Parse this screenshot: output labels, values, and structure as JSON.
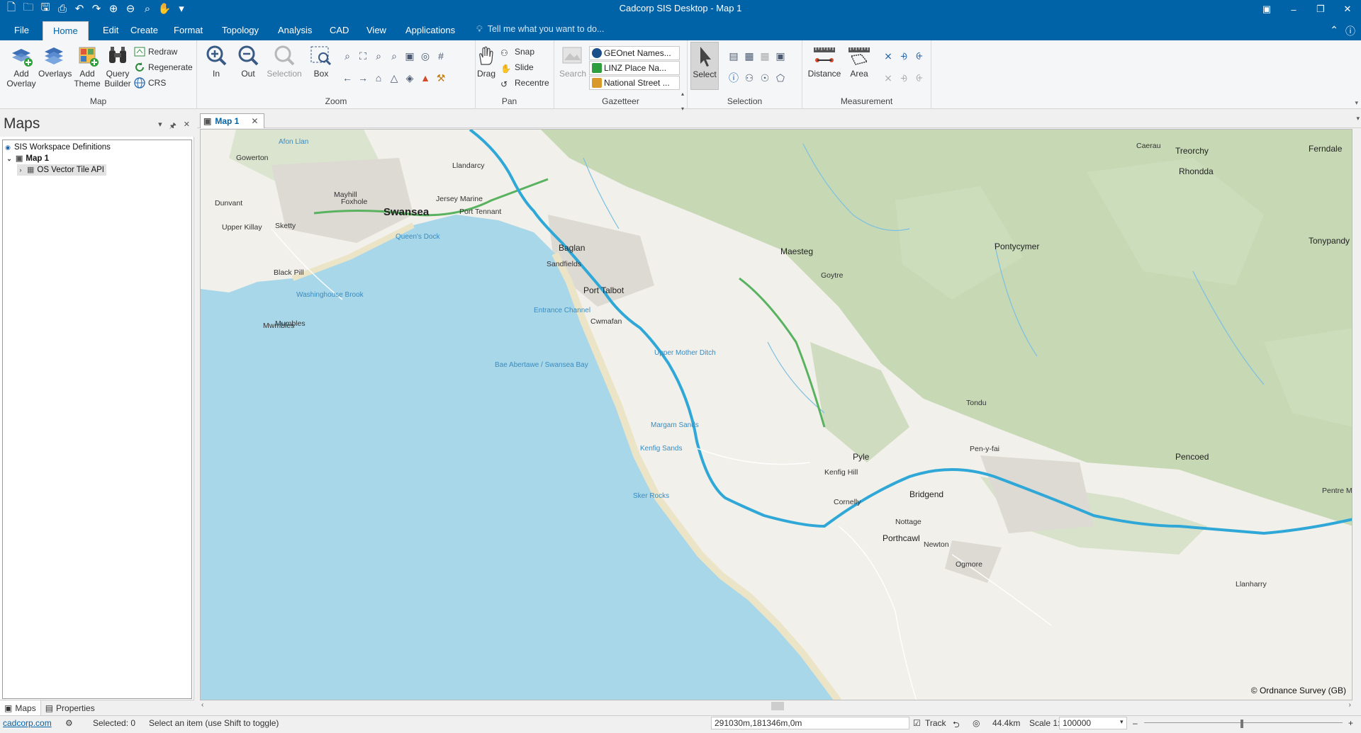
{
  "window": {
    "title": "Cadcorp SIS Desktop - Map 1"
  },
  "ribbon_tabs": [
    "File",
    "Home",
    "Edit",
    "Create",
    "Format",
    "Topology",
    "Analysis",
    "CAD",
    "View",
    "Applications"
  ],
  "tell_me": "Tell me what you want to do...",
  "groups": {
    "map": {
      "label": "Map",
      "add_overlay": "Add Overlay",
      "overlays": "Overlays",
      "add_theme": "Add Theme",
      "query_builder": "Query Builder",
      "redraw": "Redraw",
      "regenerate": "Regenerate",
      "crs": "CRS"
    },
    "zoom": {
      "label": "Zoom",
      "in": "In",
      "out": "Out",
      "selection": "Selection",
      "box": "Box"
    },
    "pan": {
      "label": "Pan",
      "drag": "Drag",
      "snap": "Snap",
      "slide": "Slide",
      "recentre": "Recentre"
    },
    "gazetteer": {
      "label": "Gazetteer",
      "search": "Search",
      "items": [
        "GEOnet Names...",
        "LINZ Place Na...",
        "National Street ..."
      ]
    },
    "selection": {
      "label": "Selection",
      "select": "Select"
    },
    "measurement": {
      "label": "Measurement",
      "distance": "Distance",
      "area": "Area"
    }
  },
  "left_panel": {
    "title": "Maps",
    "tree": [
      "SIS Workspace Definitions",
      "Map 1",
      "OS Vector Tile API"
    ],
    "footer_tabs": [
      "Maps",
      "Properties"
    ]
  },
  "doc_tab": "Map 1",
  "map": {
    "copyright": "© Ordnance Survey (GB)",
    "labels": [
      {
        "t": "Swansea",
        "c": "city"
      },
      {
        "t": "Port Talbot",
        "c": "town"
      },
      {
        "t": "Baglan",
        "c": "town"
      },
      {
        "t": "Bridgend",
        "c": "town"
      },
      {
        "t": "Maesteg",
        "c": "town"
      },
      {
        "t": "Porthcawl",
        "c": "town"
      },
      {
        "t": "Pencoed",
        "c": "town"
      },
      {
        "t": "Pyle",
        "c": "town"
      },
      {
        "t": "Rhondda",
        "c": "town"
      },
      {
        "t": "Tonypandy",
        "c": "town"
      },
      {
        "t": "Treorchy",
        "c": "town"
      },
      {
        "t": "Ferndale",
        "c": "town"
      },
      {
        "t": "Pontycymer",
        "c": "town"
      },
      {
        "t": "Bae Abertawe / Swansea Bay",
        "c": "water"
      },
      {
        "t": "Margam Sands",
        "c": "water"
      },
      {
        "t": "Kenfig Sands",
        "c": "water"
      },
      {
        "t": "Entrance Channel",
        "c": "water"
      },
      {
        "t": "Queen's Dock",
        "c": "water"
      },
      {
        "t": "Afon Llan",
        "c": "water"
      },
      {
        "t": "Washinghouse Brook",
        "c": "water"
      },
      {
        "t": "Upper Mother Ditch",
        "c": "water"
      },
      {
        "t": "Sker Rocks",
        "c": "water"
      },
      {
        "t": "Mumbles",
        "c": "village"
      },
      {
        "t": "Gowerton",
        "c": "village"
      },
      {
        "t": "Dunvant",
        "c": "village"
      },
      {
        "t": "Upper Killay",
        "c": "village"
      },
      {
        "t": "Sketty",
        "c": "village"
      },
      {
        "t": "Black Pill",
        "c": "village"
      },
      {
        "t": "Mayhill",
        "c": "village"
      },
      {
        "t": "Foxhole",
        "c": "village"
      },
      {
        "t": "Llandarcy",
        "c": "village"
      },
      {
        "t": "Jersey Marine",
        "c": "village"
      },
      {
        "t": "Port Tennant",
        "c": "village"
      },
      {
        "t": "Sandfields",
        "c": "village"
      },
      {
        "t": "Goytre",
        "c": "village"
      },
      {
        "t": "Cwmafan",
        "c": "village"
      },
      {
        "t": "Kenfig Hill",
        "c": "village"
      },
      {
        "t": "Cornelly",
        "c": "village"
      },
      {
        "t": "Newton",
        "c": "village"
      },
      {
        "t": "Nottage",
        "c": "village"
      },
      {
        "t": "Pen-y-fai",
        "c": "village"
      },
      {
        "t": "Ogmore",
        "c": "village"
      },
      {
        "t": "Tondu",
        "c": "village"
      },
      {
        "t": "Caerau",
        "c": "village"
      },
      {
        "t": "Llanharry",
        "c": "village"
      },
      {
        "t": "Pentre Meyrick",
        "c": "village"
      },
      {
        "t": "Mwmbles",
        "c": "village"
      }
    ]
  },
  "status": {
    "link": "cadcorp.com",
    "selected": "Selected: 0",
    "hint": "Select an item (use Shift to toggle)",
    "coords": "291030m,181346m,0m",
    "track": "Track",
    "distance": "44.4km",
    "scale_label": "Scale 1:",
    "scale_value": "100000"
  },
  "colors": {
    "brand": "#0063a8",
    "sea": "#a8d7e9",
    "motorway": "#2fa8d8",
    "a_road": "#59b25f",
    "land": "#f1f0ea",
    "woodland": "#b5cfa1"
  }
}
